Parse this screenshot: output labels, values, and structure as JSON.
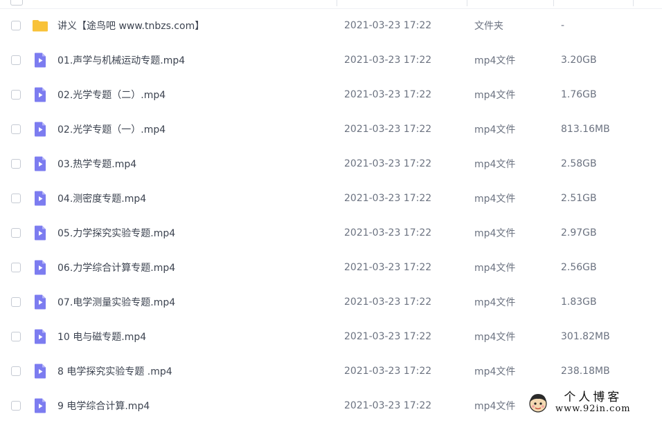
{
  "colors": {
    "folder_icon": "#f8c23a",
    "video_icon": "#7c7cf0",
    "checkbox_border": "#c5cad3",
    "row_text": "#3c4350",
    "meta_text": "#6b7280"
  },
  "files": [
    {
      "name": "讲义【途鸟吧 www.tnbzs.com】",
      "date": "2021-03-23 17:22",
      "type": "文件夹",
      "size": "-",
      "icon": "folder-icon"
    },
    {
      "name": "01.声学与机械运动专题.mp4",
      "date": "2021-03-23 17:22",
      "type": "mp4文件",
      "size": "3.20GB",
      "icon": "video-file-icon"
    },
    {
      "name": "02.光学专题（二）.mp4",
      "date": "2021-03-23 17:22",
      "type": "mp4文件",
      "size": "1.76GB",
      "icon": "video-file-icon"
    },
    {
      "name": "02.光学专题（一）.mp4",
      "date": "2021-03-23 17:22",
      "type": "mp4文件",
      "size": "813.16MB",
      "icon": "video-file-icon"
    },
    {
      "name": "03.热学专题.mp4",
      "date": "2021-03-23 17:22",
      "type": "mp4文件",
      "size": "2.58GB",
      "icon": "video-file-icon"
    },
    {
      "name": "04.测密度专题.mp4",
      "date": "2021-03-23 17:22",
      "type": "mp4文件",
      "size": "2.51GB",
      "icon": "video-file-icon"
    },
    {
      "name": "05.力学探究实验专题.mp4",
      "date": "2021-03-23 17:22",
      "type": "mp4文件",
      "size": "2.97GB",
      "icon": "video-file-icon"
    },
    {
      "name": "06.力学综合计算专题.mp4",
      "date": "2021-03-23 17:22",
      "type": "mp4文件",
      "size": "2.56GB",
      "icon": "video-file-icon"
    },
    {
      "name": "07.电学测量实验专题.mp4",
      "date": "2021-03-23 17:22",
      "type": "mp4文件",
      "size": "1.83GB",
      "icon": "video-file-icon"
    },
    {
      "name": "10 电与磁专题.mp4",
      "date": "2021-03-23 17:22",
      "type": "mp4文件",
      "size": "301.82MB",
      "icon": "video-file-icon"
    },
    {
      "name": "8 电学探究实验专题 .mp4",
      "date": "2021-03-23 17:22",
      "type": "mp4文件",
      "size": "238.18MB",
      "icon": "video-file-icon"
    },
    {
      "name": "9 电学综合计算.mp4",
      "date": "2021-03-23 17:22",
      "type": "mp4文件",
      "size": "",
      "icon": "video-file-icon"
    }
  ],
  "watermark": {
    "title": "个人博客",
    "url": "www.92in.com"
  }
}
